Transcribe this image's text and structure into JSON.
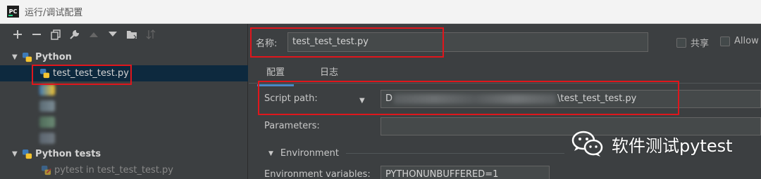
{
  "window": {
    "title": "运行/调试配置",
    "app_icon": "pycharm-logo"
  },
  "toolbar": {
    "icons": [
      "add-icon",
      "remove-icon",
      "copy-icon",
      "wrench-icon",
      "move-up-icon",
      "move-down-icon",
      "folder-icon",
      "sort-icon"
    ]
  },
  "tree": {
    "groups": [
      {
        "label": "Python",
        "expanded": true
      },
      {
        "label": "Python tests",
        "expanded": true
      }
    ],
    "selected_item": "test_test_test.py",
    "test_item": "pytest in test_test_test.py"
  },
  "config": {
    "name_label": "名称:",
    "name_value": "test_test_test.py",
    "share_label": "共享",
    "allow_label": "Allow",
    "tabs": [
      "配置",
      "日志"
    ],
    "script_path_label": "Script path:",
    "script_path_prefix": "D",
    "script_path_suffix": "\\test_test_test.py",
    "parameters_label": "Parameters:",
    "environment_label": "Environment",
    "env_vars_label": "Environment variables:",
    "env_vars_value": "PYTHONUNBUFFERED=1"
  },
  "watermark": {
    "text": "软件测试pytest",
    "icon": "wechat-icon"
  },
  "colors": {
    "highlight_red": "#e0161c",
    "selection": "#0d293e",
    "tab_underline": "#4a88c7"
  }
}
